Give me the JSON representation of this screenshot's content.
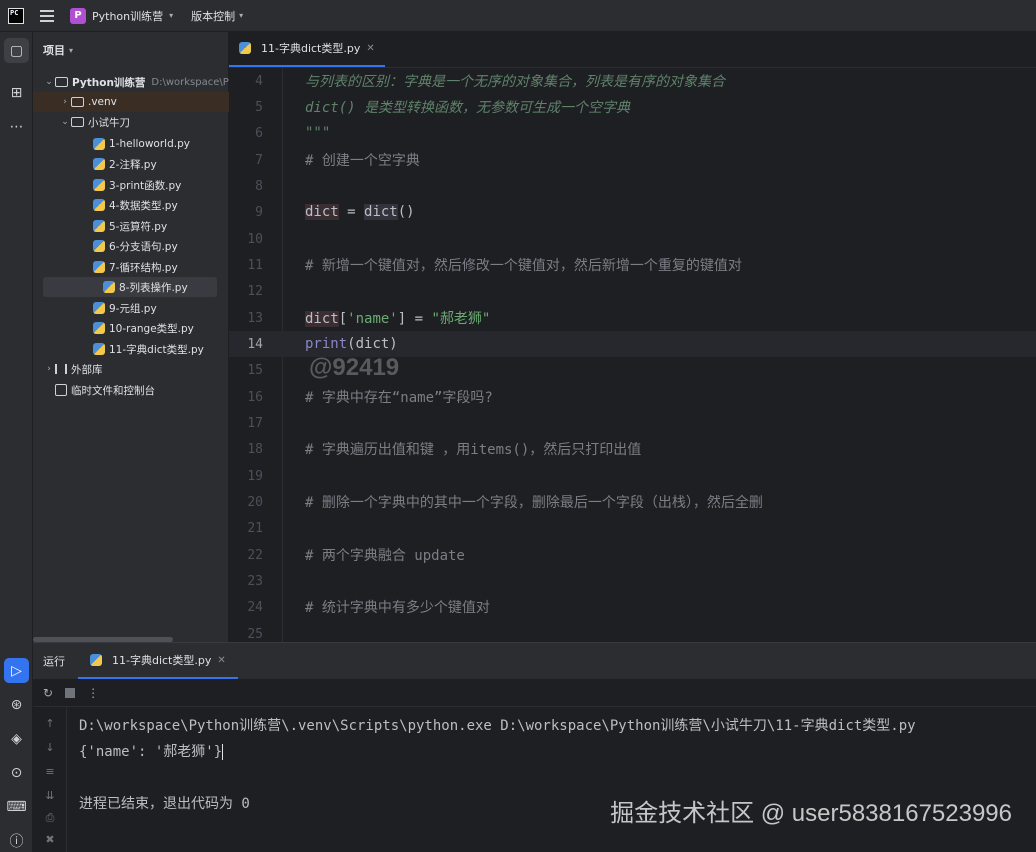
{
  "titlebar": {
    "project_badge": "P",
    "project_name": "Python训练营",
    "vcs_label": "版本控制"
  },
  "project_panel": {
    "header": "项目",
    "root_name": "Python训练营",
    "root_path": "D:\\workspace\\P",
    "venv": ".venv",
    "folder": "小试牛刀",
    "files": [
      "1-helloworld.py",
      "2-注释.py",
      "3-print函数.py",
      "4-数据类型.py",
      "5-运算符.py",
      "6-分支语句.py",
      "7-循环结构.py",
      "8-列表操作.py",
      "9-元组.py",
      "10-range类型.py",
      "11-字典dict类型.py"
    ],
    "external_libs": "外部库",
    "scratches": "临时文件和控制台"
  },
  "editor": {
    "tab_label": "11-字典dict类型.py",
    "line_numbers": [
      "4",
      "5",
      "6",
      "7",
      "8",
      "9",
      "10",
      "11",
      "12",
      "13",
      "14",
      "15",
      "16",
      "17",
      "18",
      "19",
      "20",
      "21",
      "22",
      "23",
      "24",
      "25"
    ],
    "line4": "与列表的区别：字典是一个无序的对象集合，列表是有序的对象集合",
    "line5": "dict() 是类型转换函数，无参数可生成一个空字典",
    "line6": "\"\"\"",
    "line7": "# 创建一个空字典",
    "line9_var": "dict",
    "line9_eq": " = ",
    "line9_call": "dict",
    "line9_paren": "()",
    "line11": "# 新增一个键值对，然后修改一个键值对，然后新增一个重复的键值对",
    "line13_var": "dict",
    "line13_open": "[",
    "line13_key": "'name'",
    "line13_close": "] = ",
    "line13_val": "\"郝老狮\"",
    "line14_fn": "print",
    "line14_rest": "(dict)",
    "line16": "# 字典中存在“name”字段吗?",
    "line18": "# 字典遍历出值和键 ，用items()，然后只打印出值",
    "line20": "# 删除一个字典中的其中一个字段，删除最后一个字段（出栈），然后全删",
    "line22": "# 两个字典融合 update",
    "line24": "# 统计字典中有多少个键值对",
    "watermark": "@92419"
  },
  "run_panel": {
    "title": "运行",
    "tab_label": "11-字典dict类型.py",
    "console_cmd": "D:\\workspace\\Python训练营\\.venv\\Scripts\\python.exe D:\\workspace\\Python训练营\\小试牛刀\\11-字典dict类型.py",
    "console_output": "{'name': '郝老狮'}",
    "console_exit": "进程已结束，退出代码为 0"
  },
  "brand_watermark": "掘金技术社区 @ user5838167523996"
}
